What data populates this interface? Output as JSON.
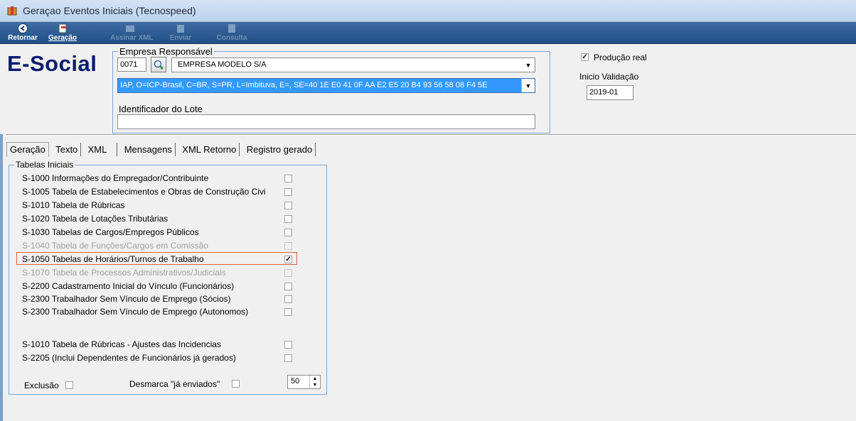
{
  "window": {
    "title": "Geraçao Eventos Iniciais (Tecnospeed)"
  },
  "toolbar": {
    "buttons": [
      {
        "label": "Retornar",
        "icon": "back-arrow-icon",
        "enabled": true
      },
      {
        "label": "Geração",
        "icon": "generate-icon",
        "enabled": true
      },
      {
        "label": "Assinar XML",
        "icon": "sign-icon",
        "enabled": false
      },
      {
        "label": "Enviar",
        "icon": "send-icon",
        "enabled": false
      },
      {
        "label": "Consulta",
        "icon": "query-icon",
        "enabled": false
      }
    ]
  },
  "header": {
    "app_label": "E-Social",
    "empresa_legend": "Empresa Responsável",
    "empresa_code": "0071",
    "empresa_name": "EMPRESA MODELO S/A",
    "certificate": "IAP, O=ICP-Brasil, C=BR, S=PR, L=Imbituva, E=, SE=40 1E E0 41 0F AA E2 E5 20 B4 93 56 58 08 F4 5E",
    "lote_label": "Identificador do Lote",
    "lote_value": "",
    "producao_label": "Produção real",
    "producao_checked": true,
    "inicio_label": "Inicio Validação",
    "inicio_value": "2019-01"
  },
  "tabs": [
    "Geração",
    "Texto",
    "XML",
    "Mensagens",
    "XML Retorno",
    "Registro gerado"
  ],
  "active_tab": "Geração",
  "tabelas": {
    "legend": "Tabelas Iniciais",
    "items": [
      {
        "label": "S-1000 Informações do Empregador/Contribuinte",
        "checked": false,
        "enabled": true
      },
      {
        "label": "S-1005 Tabela de Estabelecimentos e Obras de Construção Civi",
        "checked": false,
        "enabled": true
      },
      {
        "label": "S-1010 Tabela de Rúbricas",
        "checked": false,
        "enabled": true
      },
      {
        "label": "S-1020 Tabela de Lotações Tributárias",
        "checked": false,
        "enabled": true
      },
      {
        "label": "S-1030 Tabelas de Cargos/Empregos Públicos",
        "checked": false,
        "enabled": true
      },
      {
        "label": "S-1040 Tabela de Funções/Cargos em Comissão",
        "checked": false,
        "enabled": false
      },
      {
        "label": "S-1050 Tabelas de Horários/Turnos de Trabalho",
        "checked": true,
        "enabled": true
      },
      {
        "label": "S-1070 Tabela de Processos Administrativos/Judiciais",
        "checked": false,
        "enabled": false
      },
      {
        "label": "S-2200 Cadastramento Inicial do Vínculo (Funcionários)",
        "checked": false,
        "enabled": true
      },
      {
        "label": "S-2300 Trabalhador Sem Vínculo de Emprego (Sócios)",
        "checked": false,
        "enabled": true
      },
      {
        "label": "S-2300 Trabalhador Sem Vínculo de Emprego (Autonomos)",
        "checked": false,
        "enabled": true
      },
      {
        "label": "S-1010 Tabela de Rúbricas - Ajustes das Incidencias",
        "checked": false,
        "enabled": true
      },
      {
        "label": "S-2205 (Inclui Dependentes de Funcionários já gerados)",
        "checked": false,
        "enabled": true
      }
    ],
    "exclusao_label": "Exclusão",
    "desmarca_label": "Desmarca \"já enviados\"",
    "spin_value": "50"
  }
}
